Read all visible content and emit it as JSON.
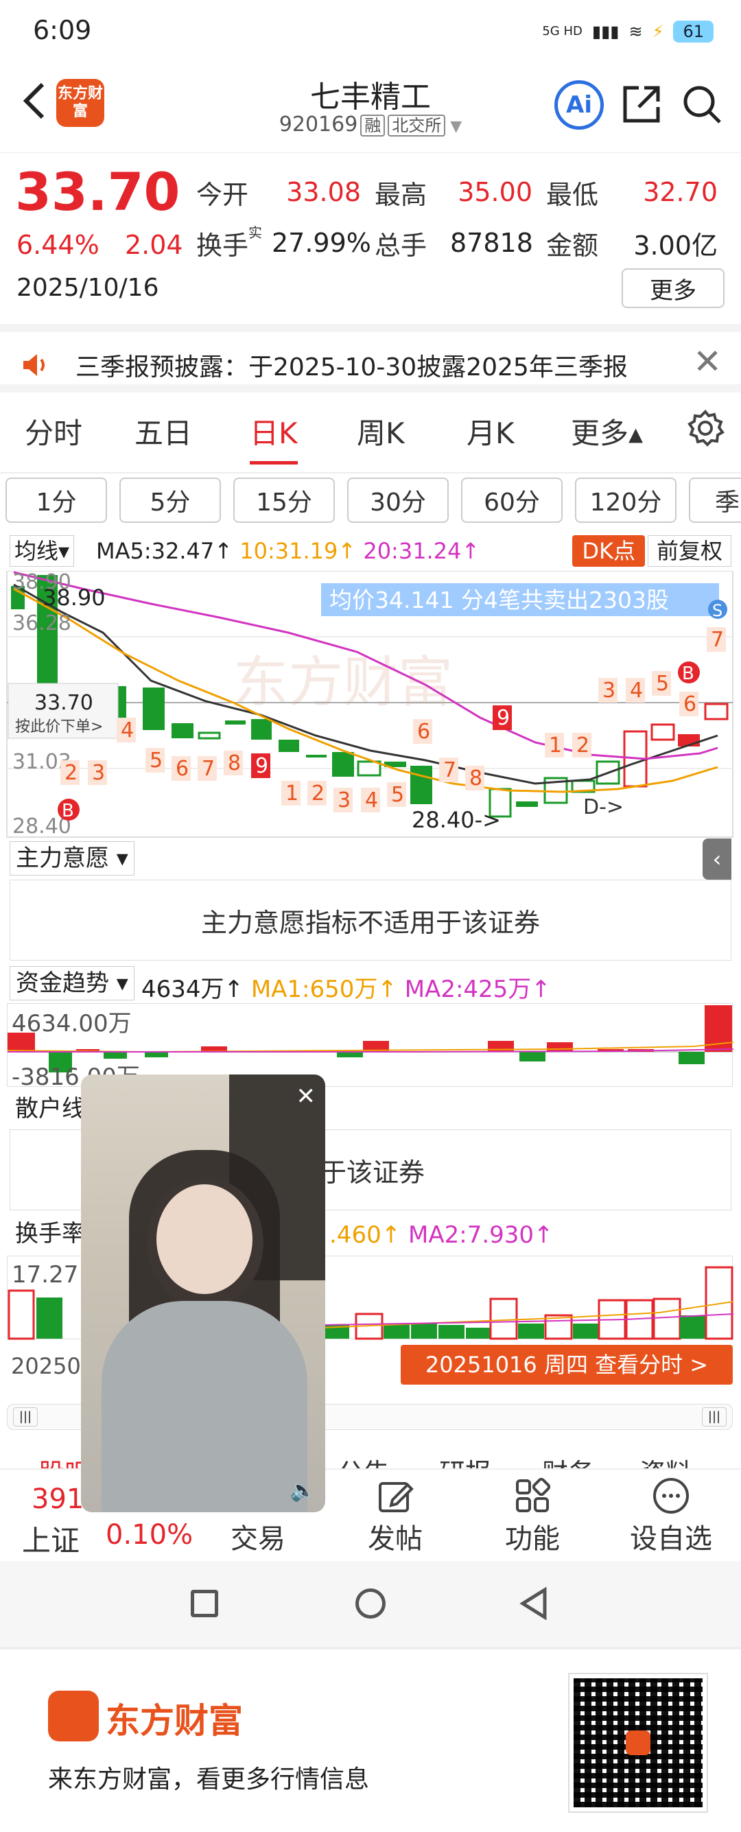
{
  "status": {
    "time": "6:09",
    "network": "5G HD",
    "battery": "61"
  },
  "header": {
    "back_icon": "chevron-left-icon",
    "logo_text": "东方财富",
    "title": "七丰精工",
    "code": "920169",
    "tag1": "融",
    "tag2": "北交所",
    "ai_label": "Ai"
  },
  "quote": {
    "price": "33.70",
    "pct": "6.44%",
    "chg": "2.04",
    "date": "2025/10/16",
    "open_label": "今开",
    "open": "33.08",
    "high_label": "最高",
    "high": "35.00",
    "low_label": "最低",
    "low": "32.70",
    "turnover_label": "换手",
    "turnover_sup": "实",
    "turnover": "27.99%",
    "volume_label": "总手",
    "volume": "87818",
    "amount_label": "金额",
    "amount": "3.00亿",
    "more_label": "更多"
  },
  "notice": {
    "text": "三季报预披露：于2025-10-30披露2025年三季报"
  },
  "tabs": [
    "分时",
    "五日",
    "日K",
    "周K",
    "月K",
    "更多▴"
  ],
  "active_tab": "日K",
  "chips": [
    "1分",
    "5分",
    "15分",
    "30分",
    "60分",
    "120分",
    "季"
  ],
  "indicator": {
    "selector": "均线▾",
    "ma5": "MA5:32.47↑",
    "ma10": "10:31.19↑",
    "ma20": "20:31.24↑",
    "dk": "DK点",
    "fuquan": "前复权"
  },
  "kchart": {
    "y_top": "38.90",
    "y_2": "36.28",
    "y_3": "31.03",
    "y_bottom": "28.40",
    "high_marker": "38.90",
    "low_marker": "28.40->",
    "price_tag": "33.70",
    "order_hint": "按此价下单>",
    "tooltip": "均价34.141  分4笔共卖出2303股",
    "d_marker": "D->"
  },
  "main_force": {
    "label": "主力意愿 ▾",
    "message": "主力意愿指标不适用于该证券"
  },
  "fund_trend": {
    "label": "资金趋势 ▾",
    "value": "4634万↑",
    "ma1": "MA1:650万↑",
    "ma2": "MA2:425万↑",
    "y_top": "4634.00万",
    "y_bottom": "-3816.00万"
  },
  "retail": {
    "label": "散户线",
    "message": "标不适用于该证券"
  },
  "turnover_ind": {
    "label": "换手率",
    "ma1": ".460↑",
    "ma2": "MA2:7.930↑",
    "y_top": "17.27",
    "date_left": "20250",
    "date_pill": "20251016 周四 查看分时 >"
  },
  "bottom_tabs_partial": [
    "股吧",
    "公告",
    "研报",
    "财务",
    "资料"
  ],
  "bottomnav": {
    "index_value": "391",
    "index_name": "上证",
    "index_pct": "0.10%",
    "items": [
      "交易",
      "发帖",
      "功能",
      "设自选"
    ]
  },
  "promo": {
    "brand": "东方财富",
    "slogan": "来东方财富，看更多行情信息"
  },
  "colors": {
    "red": "#e4252b",
    "green": "#1a9a2a",
    "orange": "#e8521d",
    "ma10": "#f0a000",
    "ma20": "#d233c0"
  }
}
